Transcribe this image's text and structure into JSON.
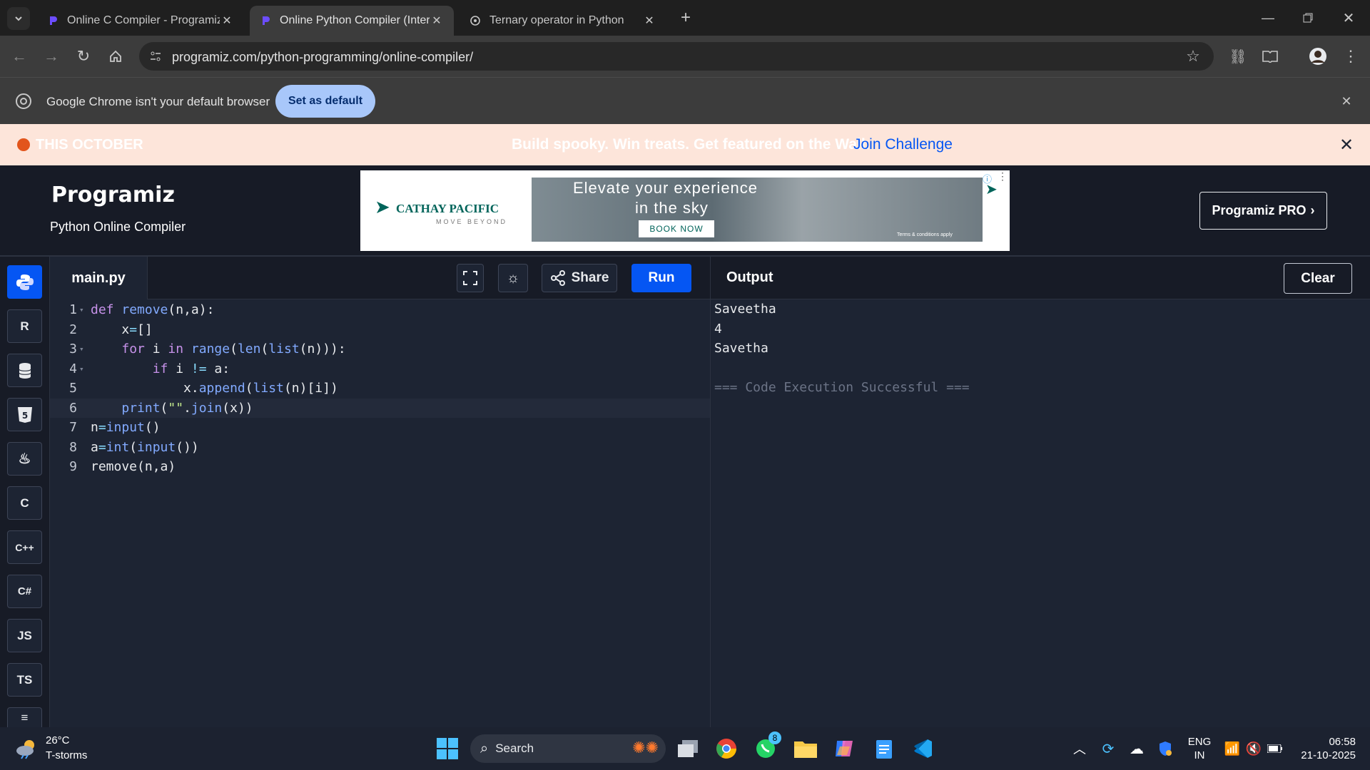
{
  "browser": {
    "tabs": [
      {
        "title": "Online C Compiler - Programiz",
        "active": false
      },
      {
        "title": "Online Python Compiler (Interpreter)",
        "active": true
      },
      {
        "title": "Ternary operator in Python",
        "active": false
      }
    ],
    "url": "programiz.com/python-programming/online-compiler/",
    "infobar": {
      "message": "Google Chrome isn't your default browser",
      "button": "Set as default"
    }
  },
  "promo": {
    "badge": "THIS OCTOBER",
    "text": "Build spooky. Win treats. Get featured on the Wall.",
    "link": "Join Challenge"
  },
  "header": {
    "logo": "Programiz",
    "subtitle": "Python Online Compiler",
    "pro_button": "Programiz PRO",
    "ad": {
      "brand": "CATHAY PACIFIC",
      "tagline": "MOVE BEYOND",
      "headline_1": "Elevate your experience",
      "headline_2": "in the sky",
      "cta": "BOOK NOW",
      "fine_print": "Terms & conditions apply"
    }
  },
  "sidebar": {
    "items": [
      "python-icon",
      "r-icon",
      "sql-icon",
      "html-icon",
      "java-icon",
      "c-icon",
      "cpp-icon",
      "csharp-icon",
      "JS",
      "TS",
      "swift-icon"
    ]
  },
  "editor": {
    "filename": "main.py",
    "share_label": "Share",
    "run_label": "Run",
    "lines": [
      {
        "n": "1",
        "text": "def remove(n,a):"
      },
      {
        "n": "2",
        "text": "    x=[]"
      },
      {
        "n": "3",
        "text": "    for i in range(len(list(n))):"
      },
      {
        "n": "4",
        "text": "        if i != a:"
      },
      {
        "n": "5",
        "text": "            x.append(list(n)[i])"
      },
      {
        "n": "6",
        "text": "    print(\"\".join(x))"
      },
      {
        "n": "7",
        "text": "n=input()"
      },
      {
        "n": "8",
        "text": "a=int(input())"
      },
      {
        "n": "9",
        "text": "remove(n,a)"
      }
    ]
  },
  "output": {
    "title": "Output",
    "clear_label": "Clear",
    "lines": [
      "Saveetha",
      "4",
      "Savetha",
      "",
      "=== Code Execution Successful ==="
    ]
  },
  "taskbar": {
    "weather_temp": "26°C",
    "weather_desc": "T-storms",
    "search_placeholder": "Search",
    "whatsapp_badge": "8",
    "lang_1": "ENG",
    "lang_2": "IN",
    "time": "06:58",
    "date": "21-10-2025"
  },
  "colors": {
    "accent": "#0556f3",
    "bg": "#1d2433",
    "header": "#171b26",
    "promo_bg": "#fde5da",
    "link": "#0556f3"
  }
}
